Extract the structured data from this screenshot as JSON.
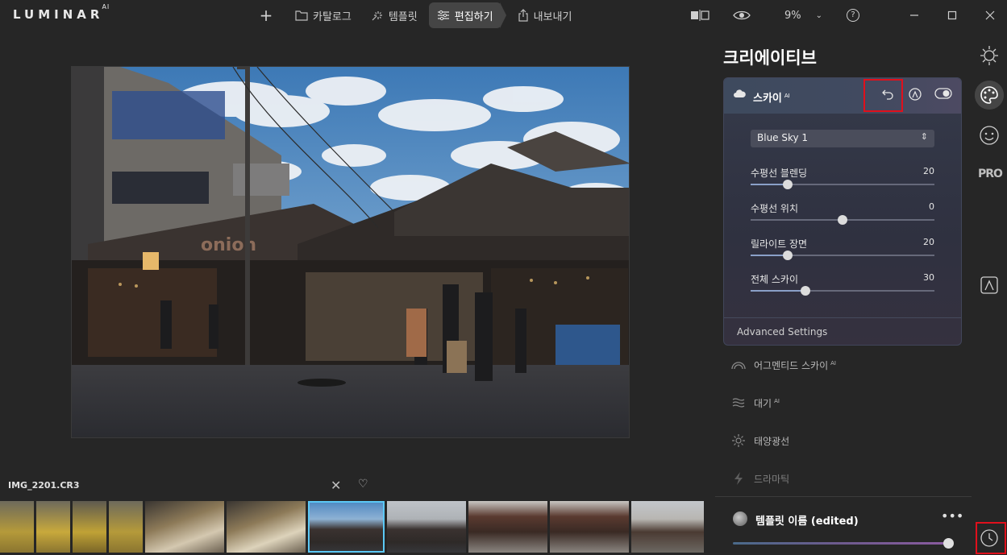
{
  "app": {
    "logo": "LUMINAR",
    "logo_sup": "AI",
    "add_label": "+"
  },
  "nav": {
    "tabs": [
      {
        "label": "카탈로그",
        "icon": "folder-icon",
        "active": false
      },
      {
        "label": "템플릿",
        "icon": "sparkle-icon",
        "active": false
      },
      {
        "label": "편집하기",
        "icon": "sliders-icon",
        "active": true
      },
      {
        "label": "내보내기",
        "icon": "export-icon",
        "active": false
      }
    ]
  },
  "toolbar": {
    "zoom": "9%",
    "help": "?"
  },
  "filmstrip": {
    "filename": "IMG_2201.CR3",
    "thumbnails": 10,
    "selected_index": 6
  },
  "panel": {
    "title": "크리에이티브",
    "sky": {
      "title": "스카이",
      "badge": "AI",
      "preset": "Blue Sky 1",
      "sliders": [
        {
          "label": "수평선 블렌딩",
          "value": "20",
          "level": 0.2
        },
        {
          "label": "수평선 위치",
          "value": "0",
          "level": 0.5
        },
        {
          "label": "릴라이트 장면",
          "value": "20",
          "level": 0.2
        },
        {
          "label": "전체 스카이",
          "value": "30",
          "level": 0.3
        }
      ],
      "advanced": "Advanced Settings"
    },
    "tools": [
      {
        "label": "어그멘티드 스카이",
        "badge": "AI",
        "icon": "augmented-sky-icon"
      },
      {
        "label": "대기",
        "badge": "AI",
        "icon": "atmosphere-icon"
      },
      {
        "label": "태양광선",
        "badge": "",
        "icon": "sunrays-icon"
      },
      {
        "label": "드라마틱",
        "badge": "",
        "icon": "dramatic-icon"
      }
    ],
    "template": {
      "name": "템플릿 이름 (edited)",
      "more": "•••",
      "amount": 1.0
    }
  },
  "rail": {
    "icons": [
      "essentials-icon",
      "creative-palette-icon",
      "portrait-face-icon",
      "pro-icon",
      "local-masking-icon",
      "history-clock-icon"
    ],
    "pro_label": "PRO"
  },
  "colors": {
    "accent": "#5bc8f5",
    "highlight_red": "#e0101c",
    "background": "#262626"
  }
}
